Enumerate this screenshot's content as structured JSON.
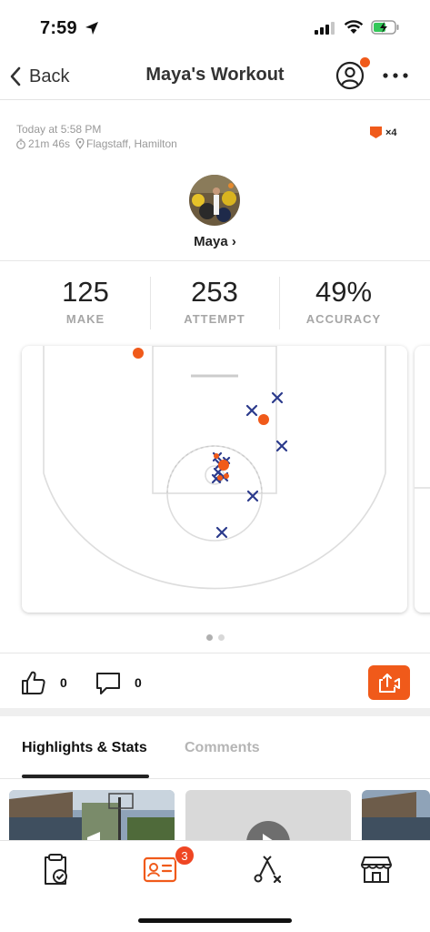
{
  "status_bar": {
    "time": "7:59"
  },
  "nav": {
    "back_label": "Back",
    "title": "Maya's Workout"
  },
  "workout": {
    "date": "Today at 5:58 PM",
    "duration": "21m 46s",
    "location": "Flagstaff, Hamilton",
    "badge_count": "×4"
  },
  "user": {
    "name": "Maya ›"
  },
  "stats": [
    {
      "value": "125",
      "label": "MAKE"
    },
    {
      "value": "253",
      "label": "ATTEMPT"
    },
    {
      "value": "49%",
      "label": "ACCURACY"
    }
  ],
  "court": {
    "colors": {
      "make": "#f05a1a",
      "miss": "#2b3a8c",
      "line": "#dddddd"
    },
    "legend_note": "",
    "pages": 2,
    "active_page": 0
  },
  "social": {
    "likes": "0",
    "comments": "0"
  },
  "tabs": {
    "highlights": "Highlights & Stats",
    "comments": "Comments"
  },
  "bottom_nav": {
    "badge": "3"
  },
  "theme": {
    "accent": "#f05a1a"
  }
}
